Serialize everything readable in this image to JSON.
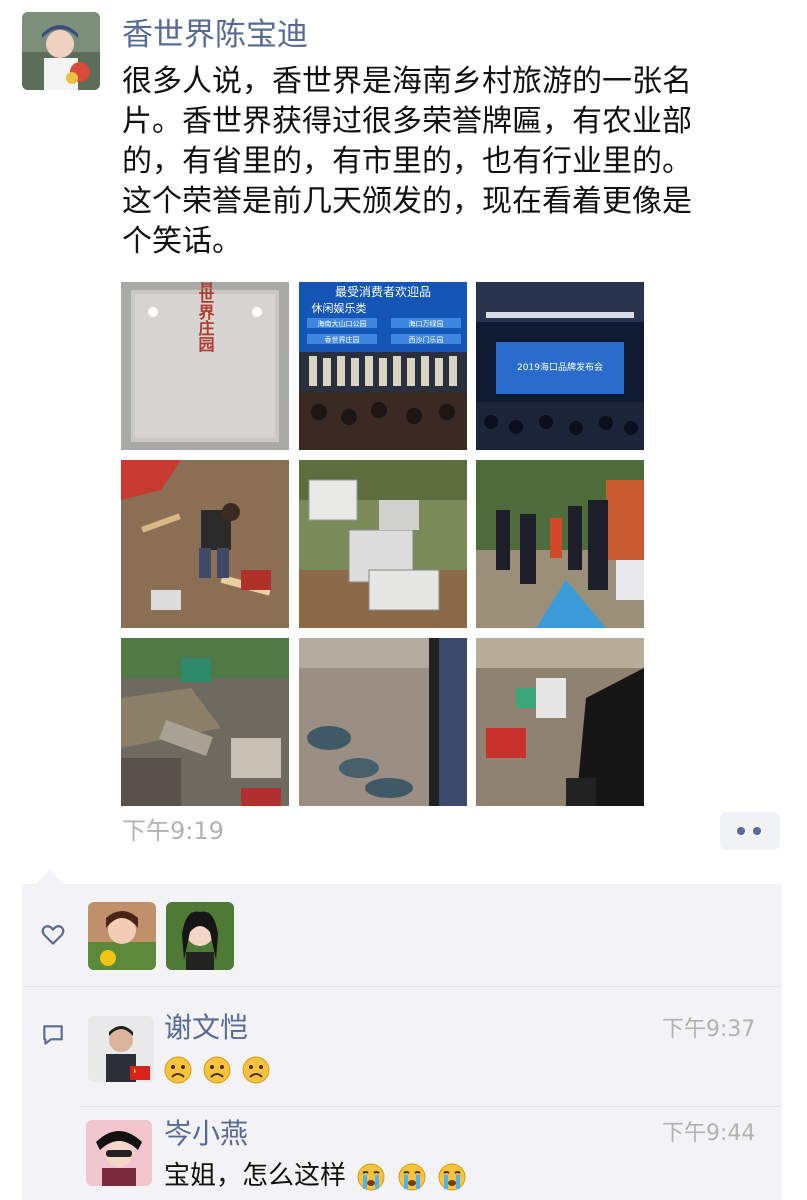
{
  "post": {
    "author": "香世界陈宝迪",
    "text_lines": [
      "很多人说，香世界是海南乡村旅游的一张名",
      "片。香世界获得过很多荣誉牌匾，有农业部",
      "的，有省里的，有市里的，也有行业里的。",
      "这个荣誉是前几天颁发的，现在看着更像是",
      "个笑话。"
    ],
    "time": "下午9:19",
    "photo_sign": "香世界庄园",
    "photo_banner_line1": "最受消费者欢迎品",
    "photo_banner_line2": "休闲娱乐类",
    "photo_banner_items": [
      "海南大山口公园",
      "海口万绿园",
      "香世界庄园",
      "西沙门乐园"
    ],
    "photo_stage_text": "2019海口品牌发布会"
  },
  "interactions": {
    "likes_icon": "heart-outline-icon",
    "comment_icon": "comment-bubble-icon",
    "more_icon": "more-dots-icon"
  },
  "comments": [
    {
      "name": "谢文恺",
      "time": "下午9:37",
      "text": "",
      "emojis": [
        "sad-face",
        "sad-face",
        "sad-face"
      ]
    },
    {
      "name": "岑小燕",
      "time": "下午9:44",
      "text": "宝姐，怎么这样",
      "emojis": [
        "crying-face",
        "crying-face",
        "crying-face"
      ]
    }
  ],
  "colors": {
    "link": "#576b95",
    "panel": "#f3f3f5",
    "time": "#b2b2b2"
  }
}
